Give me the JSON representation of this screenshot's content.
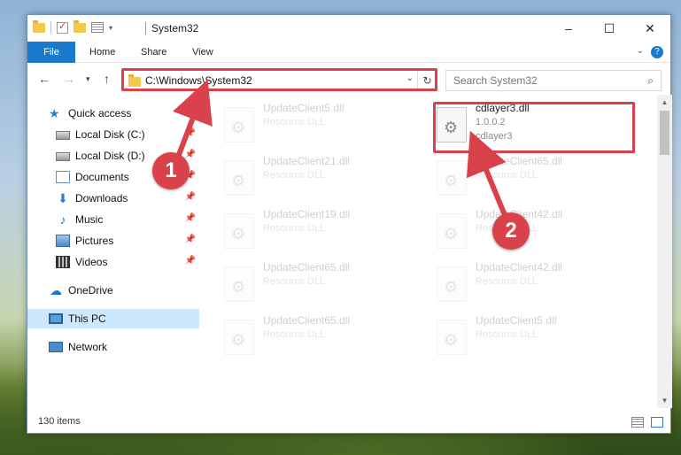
{
  "window": {
    "title": "System32",
    "controls": [
      "–",
      "☐",
      "✕"
    ]
  },
  "ribbon": {
    "tabs": [
      "File",
      "Home",
      "Share",
      "View"
    ],
    "expand_icon": "chevron-down-icon",
    "help": "?"
  },
  "address": {
    "path": "C:\\Windows\\System32",
    "search_placeholder": "Search System32"
  },
  "sidebar": {
    "items": [
      {
        "label": "Quick access",
        "icon": "star-icon"
      },
      {
        "label": "Local Disk (C:)",
        "icon": "disk-icon",
        "pinned": true
      },
      {
        "label": "Local Disk (D:)",
        "icon": "disk-icon",
        "pinned": true
      },
      {
        "label": "Documents",
        "icon": "documents-icon",
        "pinned": true
      },
      {
        "label": "Downloads",
        "icon": "download-icon",
        "pinned": true
      },
      {
        "label": "Music",
        "icon": "music-icon",
        "pinned": true
      },
      {
        "label": "Pictures",
        "icon": "pictures-icon",
        "pinned": true
      },
      {
        "label": "Videos",
        "icon": "videos-icon",
        "pinned": true
      },
      {
        "label": "OneDrive",
        "icon": "cloud-icon"
      },
      {
        "label": "This PC",
        "icon": "computer-icon",
        "selected": true
      },
      {
        "label": "Network",
        "icon": "network-icon"
      }
    ]
  },
  "files": [
    {
      "name": "UpdateClient5.dll",
      "line2": "Resource DLL",
      "line3": ""
    },
    {
      "name": "cdlayer3.dll",
      "line2": "1.0.0.2",
      "line3": "cdlayer3",
      "highlighted": true
    },
    {
      "name": "UpdateClient21.dll",
      "line2": "Resource DLL",
      "line3": ""
    },
    {
      "name": "UpdateClient65.dll",
      "line2": "Resource DLL",
      "line3": ""
    },
    {
      "name": "UpdateClient19.dll",
      "line2": "Resource DLL",
      "line3": ""
    },
    {
      "name": "UpdateClient42.dll",
      "line2": "Resource DLL",
      "line3": ""
    },
    {
      "name": "UpdateClient65.dll",
      "line2": "Resource DLL",
      "line3": ""
    },
    {
      "name": "UpdateClient42.dll",
      "line2": "Resource DLL",
      "line3": ""
    },
    {
      "name": "UpdateClient65.dll",
      "line2": "Resource DLL",
      "line3": ""
    },
    {
      "name": "UpdateClient5.dll",
      "line2": "Resource DLL",
      "line3": ""
    }
  ],
  "status": {
    "item_count": "130 items"
  },
  "callouts": [
    "1",
    "2"
  ],
  "colors": {
    "accent": "#1979ca",
    "highlight": "#d9424a",
    "selected_bg": "#cce8ff"
  }
}
